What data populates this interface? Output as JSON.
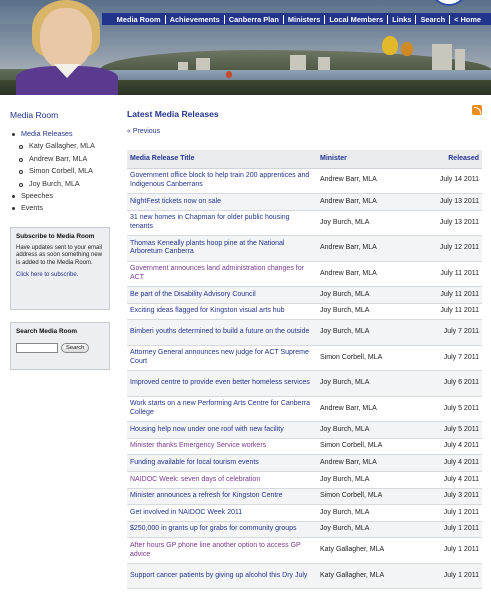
{
  "nav": {
    "items": [
      "Media Room",
      "Achievements",
      "Canberra Plan",
      "Ministers",
      "Local Members",
      "Links",
      "Search",
      "< Home"
    ]
  },
  "sidebar": {
    "title": "Media Room",
    "items": [
      {
        "label": "Media Releases",
        "level": 1
      },
      {
        "label": "Katy Gallagher, MLA",
        "level": 2
      },
      {
        "label": "Andrew Barr, MLA",
        "level": 2
      },
      {
        "label": "Simon Corbell, MLA",
        "level": 2
      },
      {
        "label": "Joy Burch, MLA",
        "level": 2
      },
      {
        "label": "Speeches",
        "level": 1
      },
      {
        "label": "Events",
        "level": 1
      }
    ],
    "subscribe": {
      "heading": "Subscribe to Media Room",
      "text": "Have updates sent to your email address as soon something new is added to the Media Room.",
      "link": "Click here to subscribe."
    },
    "search": {
      "heading": "Search Media Room",
      "input_value": "",
      "button": "Search"
    }
  },
  "main": {
    "title": "Latest Media Releases",
    "prev": "« Previous",
    "rss_icon": "rss-feed-icon",
    "columns": [
      "Media Release Title",
      "Minister",
      "Released"
    ],
    "rows": [
      {
        "title": "Government office block to help train 200 apprentices and Indigenous Canberrans",
        "minister": "Andrew Barr, MLA",
        "date": "July 14 2011",
        "visited": false
      },
      {
        "title": "NightFest tickets now on sale",
        "minister": "Andrew Barr, MLA",
        "date": "July 13 2011",
        "visited": false
      },
      {
        "title": "31 new homes in Chapman for older public housing tenants",
        "minister": "Joy Burch, MLA",
        "date": "July 13 2011",
        "visited": false
      },
      {
        "title": "Thomas Keneally plants hoop pine at the National Arboretum Canberra",
        "minister": "Andrew Barr, MLA",
        "date": "July 12 2011",
        "visited": false
      },
      {
        "title": "Government announces land administration changes for ACT",
        "minister": "Andrew Barr, MLA",
        "date": "July 11 2011",
        "visited": true
      },
      {
        "title": "Be part of the Disability Advisory Council",
        "minister": "Joy Burch, MLA",
        "date": "July 11 2011",
        "visited": false
      },
      {
        "title": "Exciting ideas flagged for Kingston visual arts hub",
        "minister": "Joy Burch, MLA",
        "date": "July 11 2011",
        "visited": false
      },
      {
        "title": "Bimberi youths determined to build a future on the outside",
        "minister": "Joy Burch, MLA",
        "date": "July 7 2011",
        "visited": false
      },
      {
        "title": "Attorney General announces new judge for ACT Supreme Court",
        "minister": "Simon Corbell, MLA",
        "date": "July 7 2011",
        "visited": false
      },
      {
        "title": "Improved centre to provide even better homeless services",
        "minister": "Joy Burch, MLA",
        "date": "July 6 2011",
        "visited": false
      },
      {
        "title": "Work starts on a new Performing Arts Centre for Canberra College",
        "minister": "Andrew Barr, MLA",
        "date": "July 5 2011",
        "visited": false
      },
      {
        "title": "Housing help now under one roof with new facility",
        "minister": "Joy Burch, MLA",
        "date": "July 5 2011",
        "visited": false
      },
      {
        "title": "Minister thanks Emergency Service workers",
        "minister": "Simon Corbell, MLA",
        "date": "July 4 2011",
        "visited": true
      },
      {
        "title": "Funding available for local tourism events",
        "minister": "Andrew Barr, MLA",
        "date": "July 4 2011",
        "visited": false
      },
      {
        "title": "NAIDOC Week: seven days of celebration",
        "minister": "Joy Burch, MLA",
        "date": "July 4 2011",
        "visited": true
      },
      {
        "title": "Minister announces a refresh for Kingston Centre",
        "minister": "Simon Corbell, MLA",
        "date": "July 3 2011",
        "visited": false
      },
      {
        "title": "Get involved in NAIDOC Week 2011",
        "minister": "Joy Burch, MLA",
        "date": "July 1 2011",
        "visited": false
      },
      {
        "title": "$250,000 in grants up for grabs for community groups",
        "minister": "Joy Burch, MLA",
        "date": "July 1 2011",
        "visited": false
      },
      {
        "title": "After hours GP phone line another option to access GP advice",
        "minister": "Katy Gallagher, MLA",
        "date": "July 1 2011",
        "visited": true
      },
      {
        "title": "Support cancer patients by giving up alcohol this Dry July",
        "minister": "Katy Gallagher, MLA",
        "date": "July 1 2011",
        "visited": false
      }
    ]
  }
}
